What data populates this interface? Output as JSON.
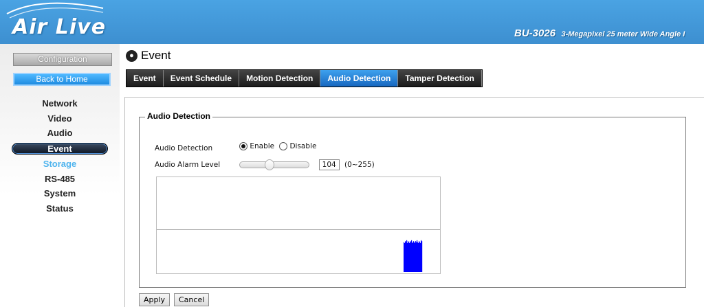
{
  "header": {
    "logo": "Air Live",
    "model": "BU-3026",
    "description": "3-Megapixel 25 meter Wide Angle I"
  },
  "sidebar": {
    "config_label": "Configuration",
    "home_label": "Back to Home",
    "items": [
      {
        "label": "Network"
      },
      {
        "label": "Video"
      },
      {
        "label": "Audio"
      },
      {
        "label": "Event",
        "active": true
      },
      {
        "label": "Storage"
      },
      {
        "label": "RS-485"
      },
      {
        "label": "System"
      },
      {
        "label": "Status"
      }
    ]
  },
  "page": {
    "title": "Event",
    "tabs": [
      {
        "label": "Event"
      },
      {
        "label": "Event Schedule"
      },
      {
        "label": "Motion Detection"
      },
      {
        "label": "Audio Detection",
        "active": true
      },
      {
        "label": "Tamper Detection"
      }
    ]
  },
  "audio": {
    "legend": "Audio Detection",
    "detection_label": "Audio Detection",
    "enable_label": "Enable",
    "disable_label": "Disable",
    "selected": "Enable",
    "alarm_label": "Audio Alarm Level",
    "alarm_value": "104",
    "alarm_range": "(0~255)",
    "alarm_level_fraction": 0.41,
    "graph_color": "#0000ff",
    "graph_threshold_fraction": 0.45,
    "graph_levels": [
      0.31,
      0.3,
      0.32,
      0.31,
      0.33,
      0.3,
      0.32,
      0.31,
      0.3,
      0.32,
      0.31,
      0.33,
      0.3,
      0.31,
      0.32,
      0.31,
      0.3,
      0.32,
      0.31,
      0.33,
      0.31,
      0.3,
      0.32,
      0.31,
      0.3,
      0.33,
      0.32
    ]
  },
  "buttons": {
    "apply": "Apply",
    "cancel": "Cancel"
  }
}
